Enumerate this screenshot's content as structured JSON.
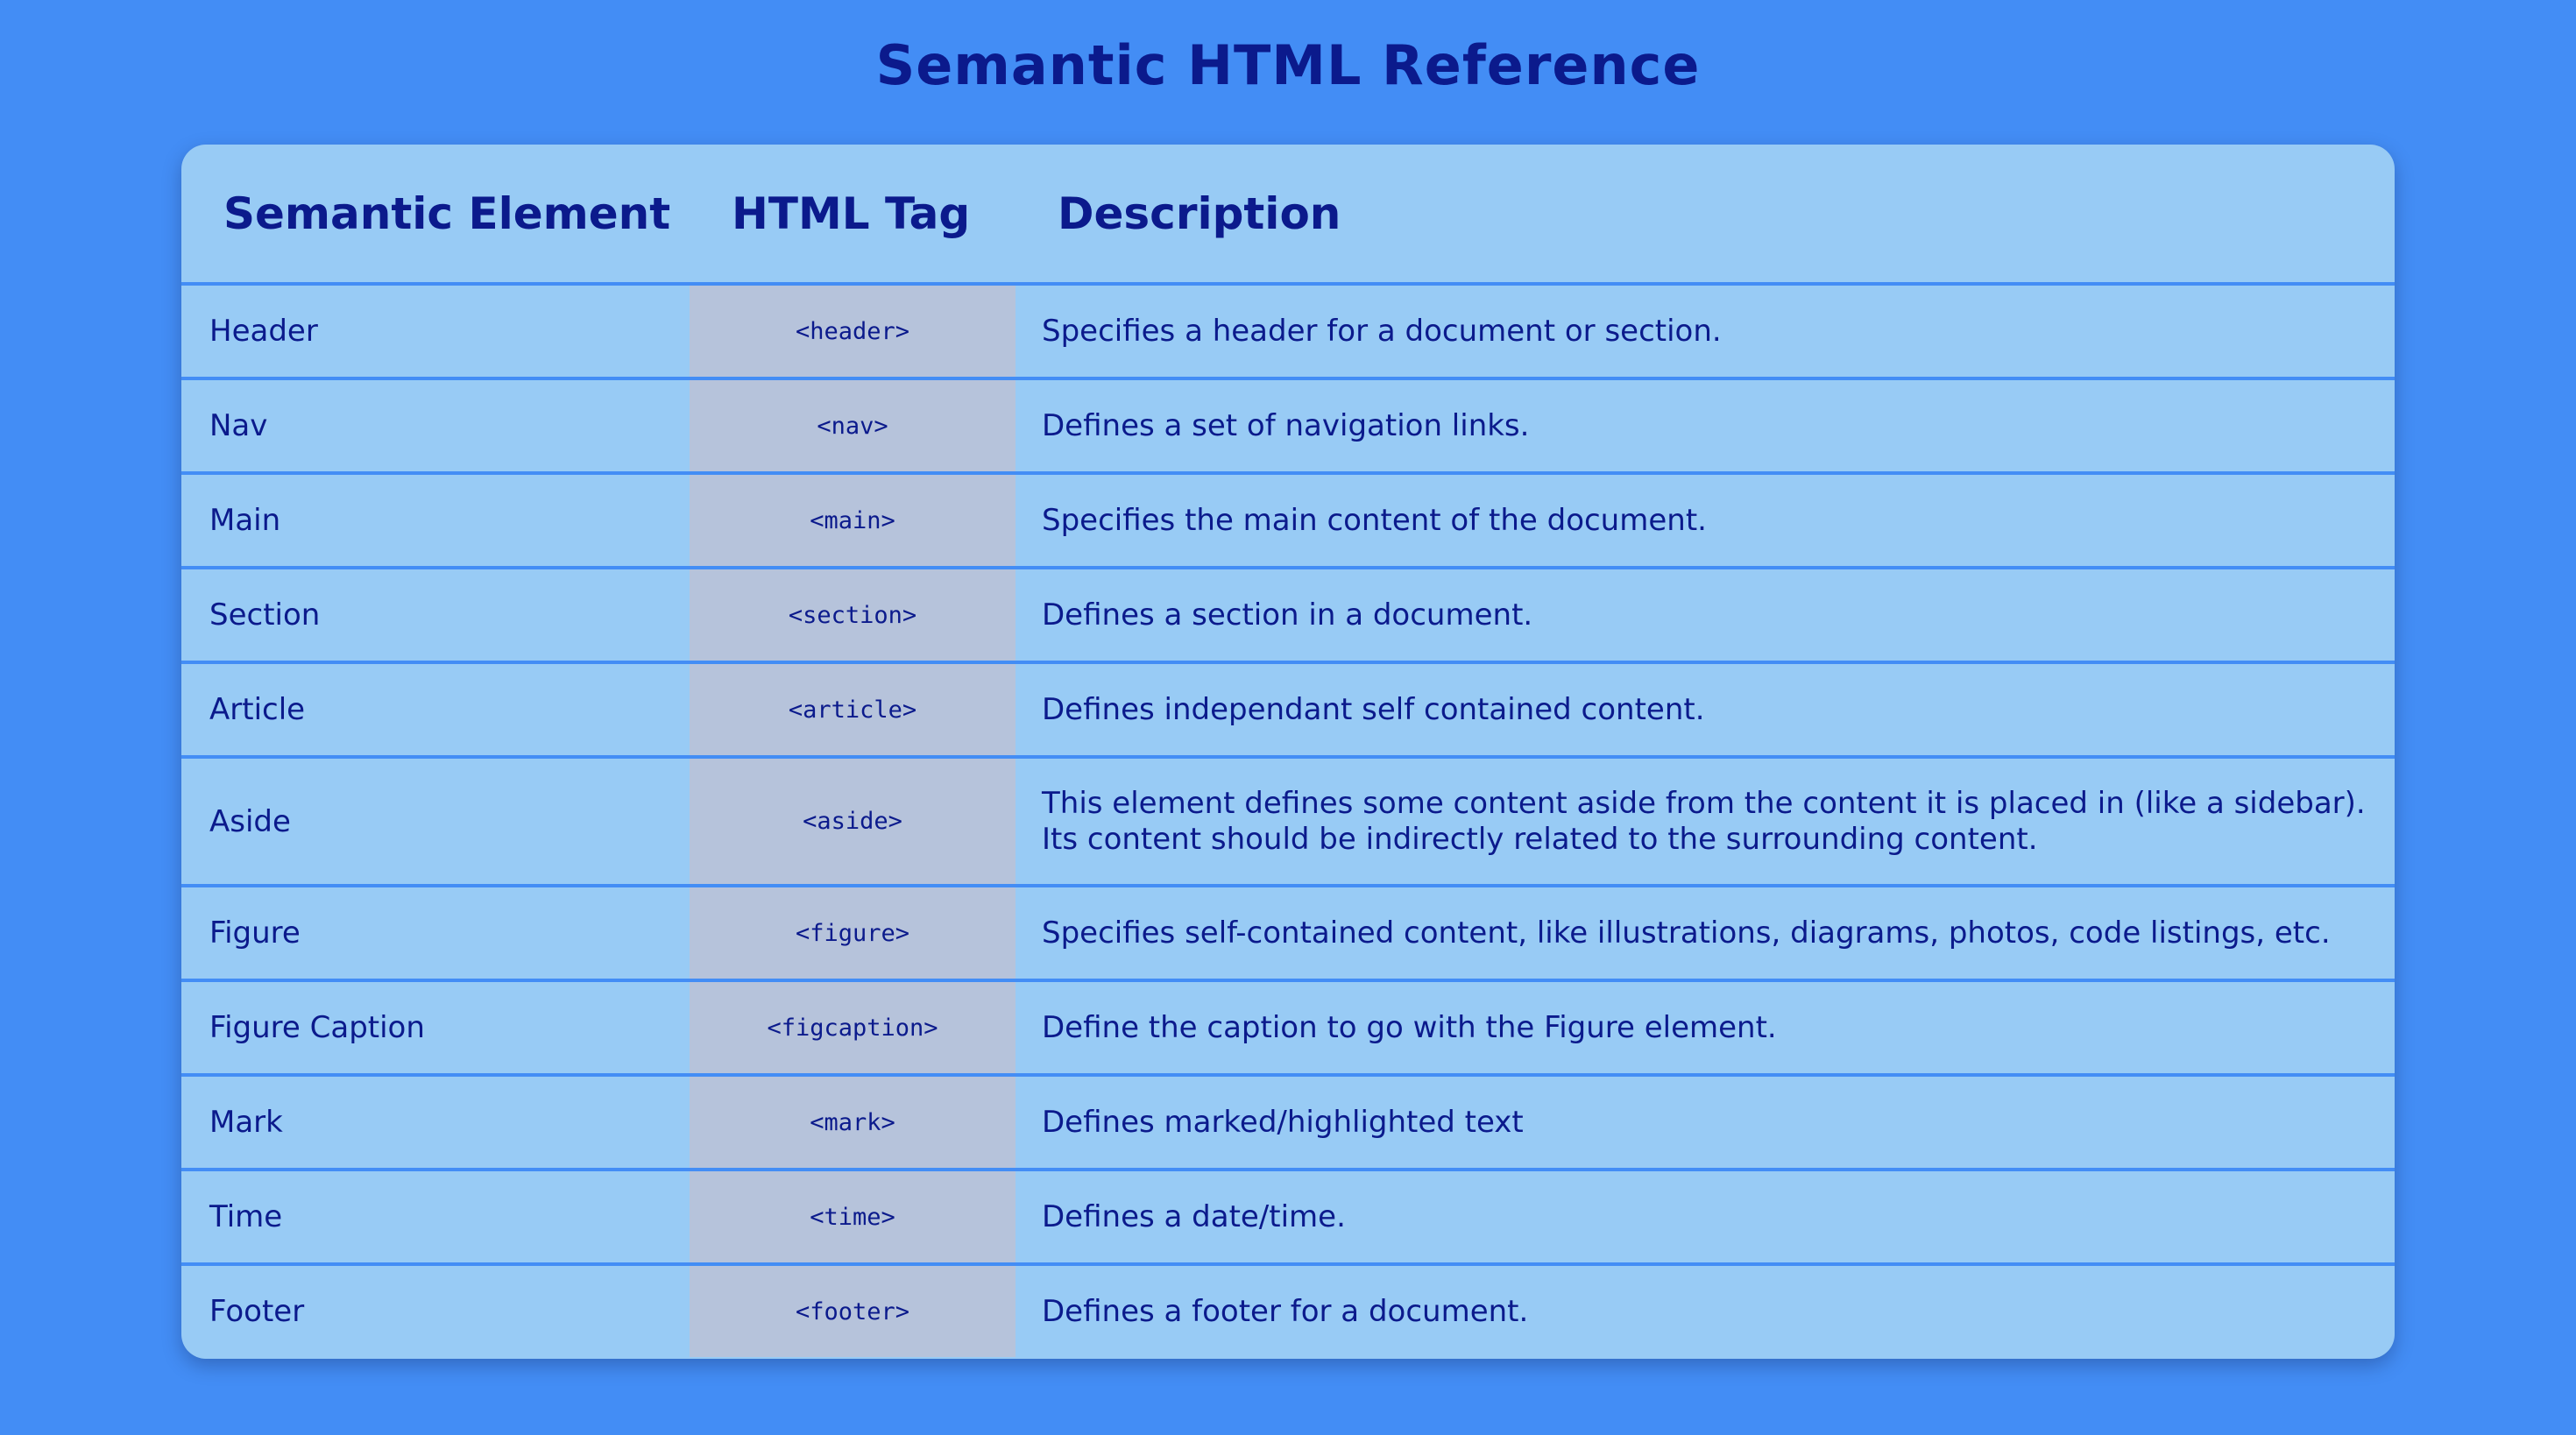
{
  "page": {
    "title": "Semantic HTML Reference"
  },
  "colors": {
    "background": "#438df5",
    "card": "#98cbf5",
    "tag_column": "#b6c3db",
    "text": "#0b1a8c"
  },
  "table": {
    "headers": [
      "Semantic Element",
      "HTML Tag",
      "Description"
    ],
    "rows": [
      {
        "element": "Header",
        "tag": "<header>",
        "description": "Specifies a header for a document or section."
      },
      {
        "element": "Nav",
        "tag": "<nav>",
        "description": "Defines a set of navigation links."
      },
      {
        "element": "Main",
        "tag": "<main>",
        "description": "Specifies the main content of the document."
      },
      {
        "element": "Section",
        "tag": "<section>",
        "description": "Defines a section in a document."
      },
      {
        "element": "Article",
        "tag": "<article>",
        "description": "Defines independant self contained content."
      },
      {
        "element": "Aside",
        "tag": "<aside>",
        "description": "This element defines some content aside from the content it is placed in (like a sidebar). Its content should be indirectly related to the surrounding content."
      },
      {
        "element": "Figure",
        "tag": "<figure>",
        "description": "Specifies self-contained content, like illustrations, diagrams, photos, code listings, etc."
      },
      {
        "element": "Figure Caption",
        "tag": "<figcaption>",
        "description": "Define the caption to go with the Figure element."
      },
      {
        "element": "Mark",
        "tag": "<mark>",
        "description": "Defines marked/highlighted text"
      },
      {
        "element": "Time",
        "tag": "<time>",
        "description": "Defines a date/time."
      },
      {
        "element": "Footer",
        "tag": "<footer>",
        "description": "Defines a footer for a document."
      }
    ]
  }
}
